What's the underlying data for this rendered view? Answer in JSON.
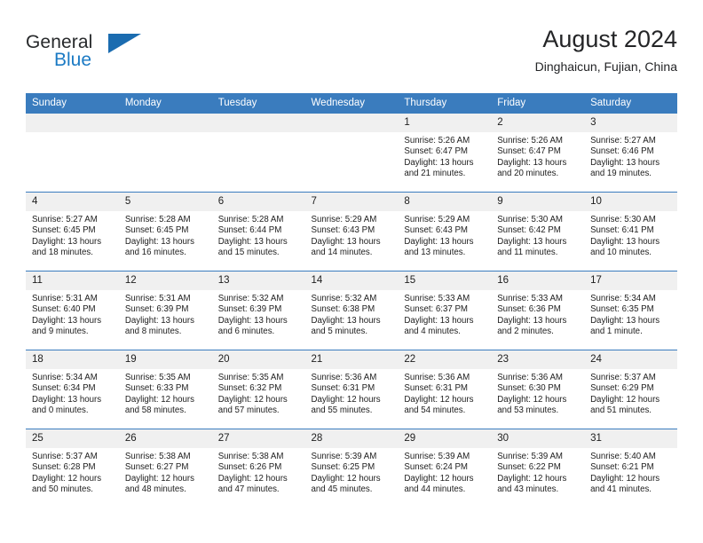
{
  "brand": {
    "name_top": "General",
    "name_bottom": "Blue",
    "accent_color": "#1b7ac4",
    "triangle_color": "#1b6cb0"
  },
  "header": {
    "month_title": "August 2024",
    "location": "Dinghaicun, Fujian, China",
    "header_bg": "#3a7cbe",
    "daynum_bg": "#f0f0f0"
  },
  "weekday_headers": [
    "Sunday",
    "Monday",
    "Tuesday",
    "Wednesday",
    "Thursday",
    "Friday",
    "Saturday"
  ],
  "weeks": [
    [
      {
        "day": "",
        "sunrise": "",
        "sunset": "",
        "daylight1": "",
        "daylight2": "",
        "blank": true
      },
      {
        "day": "",
        "sunrise": "",
        "sunset": "",
        "daylight1": "",
        "daylight2": "",
        "blank": true
      },
      {
        "day": "",
        "sunrise": "",
        "sunset": "",
        "daylight1": "",
        "daylight2": "",
        "blank": true
      },
      {
        "day": "",
        "sunrise": "",
        "sunset": "",
        "daylight1": "",
        "daylight2": "",
        "blank": true
      },
      {
        "day": "1",
        "sunrise": "Sunrise: 5:26 AM",
        "sunset": "Sunset: 6:47 PM",
        "daylight1": "Daylight: 13 hours",
        "daylight2": "and 21 minutes."
      },
      {
        "day": "2",
        "sunrise": "Sunrise: 5:26 AM",
        "sunset": "Sunset: 6:47 PM",
        "daylight1": "Daylight: 13 hours",
        "daylight2": "and 20 minutes."
      },
      {
        "day": "3",
        "sunrise": "Sunrise: 5:27 AM",
        "sunset": "Sunset: 6:46 PM",
        "daylight1": "Daylight: 13 hours",
        "daylight2": "and 19 minutes."
      }
    ],
    [
      {
        "day": "4",
        "sunrise": "Sunrise: 5:27 AM",
        "sunset": "Sunset: 6:45 PM",
        "daylight1": "Daylight: 13 hours",
        "daylight2": "and 18 minutes."
      },
      {
        "day": "5",
        "sunrise": "Sunrise: 5:28 AM",
        "sunset": "Sunset: 6:45 PM",
        "daylight1": "Daylight: 13 hours",
        "daylight2": "and 16 minutes."
      },
      {
        "day": "6",
        "sunrise": "Sunrise: 5:28 AM",
        "sunset": "Sunset: 6:44 PM",
        "daylight1": "Daylight: 13 hours",
        "daylight2": "and 15 minutes."
      },
      {
        "day": "7",
        "sunrise": "Sunrise: 5:29 AM",
        "sunset": "Sunset: 6:43 PM",
        "daylight1": "Daylight: 13 hours",
        "daylight2": "and 14 minutes."
      },
      {
        "day": "8",
        "sunrise": "Sunrise: 5:29 AM",
        "sunset": "Sunset: 6:43 PM",
        "daylight1": "Daylight: 13 hours",
        "daylight2": "and 13 minutes."
      },
      {
        "day": "9",
        "sunrise": "Sunrise: 5:30 AM",
        "sunset": "Sunset: 6:42 PM",
        "daylight1": "Daylight: 13 hours",
        "daylight2": "and 11 minutes."
      },
      {
        "day": "10",
        "sunrise": "Sunrise: 5:30 AM",
        "sunset": "Sunset: 6:41 PM",
        "daylight1": "Daylight: 13 hours",
        "daylight2": "and 10 minutes."
      }
    ],
    [
      {
        "day": "11",
        "sunrise": "Sunrise: 5:31 AM",
        "sunset": "Sunset: 6:40 PM",
        "daylight1": "Daylight: 13 hours",
        "daylight2": "and 9 minutes."
      },
      {
        "day": "12",
        "sunrise": "Sunrise: 5:31 AM",
        "sunset": "Sunset: 6:39 PM",
        "daylight1": "Daylight: 13 hours",
        "daylight2": "and 8 minutes."
      },
      {
        "day": "13",
        "sunrise": "Sunrise: 5:32 AM",
        "sunset": "Sunset: 6:39 PM",
        "daylight1": "Daylight: 13 hours",
        "daylight2": "and 6 minutes."
      },
      {
        "day": "14",
        "sunrise": "Sunrise: 5:32 AM",
        "sunset": "Sunset: 6:38 PM",
        "daylight1": "Daylight: 13 hours",
        "daylight2": "and 5 minutes."
      },
      {
        "day": "15",
        "sunrise": "Sunrise: 5:33 AM",
        "sunset": "Sunset: 6:37 PM",
        "daylight1": "Daylight: 13 hours",
        "daylight2": "and 4 minutes."
      },
      {
        "day": "16",
        "sunrise": "Sunrise: 5:33 AM",
        "sunset": "Sunset: 6:36 PM",
        "daylight1": "Daylight: 13 hours",
        "daylight2": "and 2 minutes."
      },
      {
        "day": "17",
        "sunrise": "Sunrise: 5:34 AM",
        "sunset": "Sunset: 6:35 PM",
        "daylight1": "Daylight: 13 hours",
        "daylight2": "and 1 minute."
      }
    ],
    [
      {
        "day": "18",
        "sunrise": "Sunrise: 5:34 AM",
        "sunset": "Sunset: 6:34 PM",
        "daylight1": "Daylight: 13 hours",
        "daylight2": "and 0 minutes."
      },
      {
        "day": "19",
        "sunrise": "Sunrise: 5:35 AM",
        "sunset": "Sunset: 6:33 PM",
        "daylight1": "Daylight: 12 hours",
        "daylight2": "and 58 minutes."
      },
      {
        "day": "20",
        "sunrise": "Sunrise: 5:35 AM",
        "sunset": "Sunset: 6:32 PM",
        "daylight1": "Daylight: 12 hours",
        "daylight2": "and 57 minutes."
      },
      {
        "day": "21",
        "sunrise": "Sunrise: 5:36 AM",
        "sunset": "Sunset: 6:31 PM",
        "daylight1": "Daylight: 12 hours",
        "daylight2": "and 55 minutes."
      },
      {
        "day": "22",
        "sunrise": "Sunrise: 5:36 AM",
        "sunset": "Sunset: 6:31 PM",
        "daylight1": "Daylight: 12 hours",
        "daylight2": "and 54 minutes."
      },
      {
        "day": "23",
        "sunrise": "Sunrise: 5:36 AM",
        "sunset": "Sunset: 6:30 PM",
        "daylight1": "Daylight: 12 hours",
        "daylight2": "and 53 minutes."
      },
      {
        "day": "24",
        "sunrise": "Sunrise: 5:37 AM",
        "sunset": "Sunset: 6:29 PM",
        "daylight1": "Daylight: 12 hours",
        "daylight2": "and 51 minutes."
      }
    ],
    [
      {
        "day": "25",
        "sunrise": "Sunrise: 5:37 AM",
        "sunset": "Sunset: 6:28 PM",
        "daylight1": "Daylight: 12 hours",
        "daylight2": "and 50 minutes."
      },
      {
        "day": "26",
        "sunrise": "Sunrise: 5:38 AM",
        "sunset": "Sunset: 6:27 PM",
        "daylight1": "Daylight: 12 hours",
        "daylight2": "and 48 minutes."
      },
      {
        "day": "27",
        "sunrise": "Sunrise: 5:38 AM",
        "sunset": "Sunset: 6:26 PM",
        "daylight1": "Daylight: 12 hours",
        "daylight2": "and 47 minutes."
      },
      {
        "day": "28",
        "sunrise": "Sunrise: 5:39 AM",
        "sunset": "Sunset: 6:25 PM",
        "daylight1": "Daylight: 12 hours",
        "daylight2": "and 45 minutes."
      },
      {
        "day": "29",
        "sunrise": "Sunrise: 5:39 AM",
        "sunset": "Sunset: 6:24 PM",
        "daylight1": "Daylight: 12 hours",
        "daylight2": "and 44 minutes."
      },
      {
        "day": "30",
        "sunrise": "Sunrise: 5:39 AM",
        "sunset": "Sunset: 6:22 PM",
        "daylight1": "Daylight: 12 hours",
        "daylight2": "and 43 minutes."
      },
      {
        "day": "31",
        "sunrise": "Sunrise: 5:40 AM",
        "sunset": "Sunset: 6:21 PM",
        "daylight1": "Daylight: 12 hours",
        "daylight2": "and 41 minutes."
      }
    ]
  ]
}
